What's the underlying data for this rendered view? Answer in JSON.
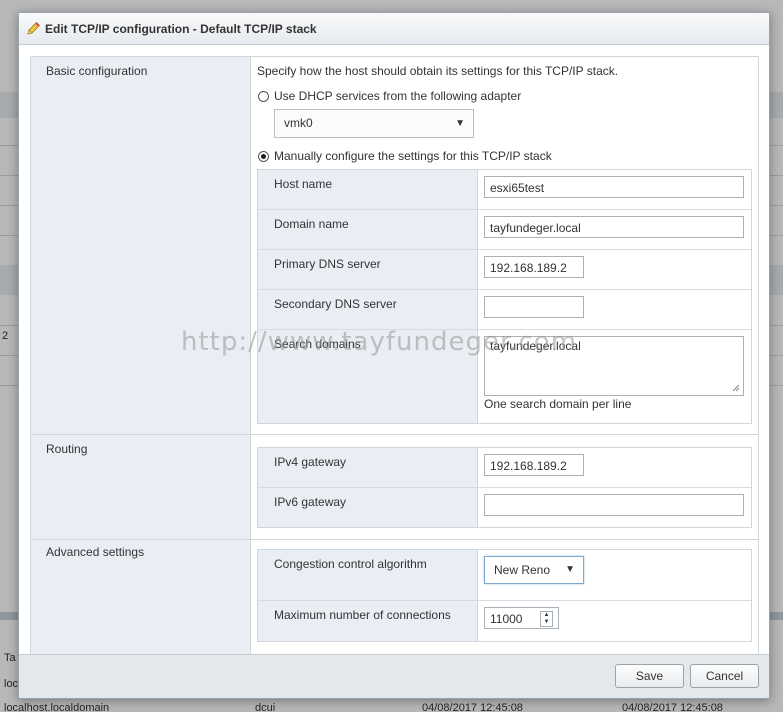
{
  "dialog": {
    "title": "Edit TCP/IP configuration - Default TCP/IP stack",
    "title_icon": "pencil-icon",
    "save_label": "Save",
    "cancel_label": "Cancel"
  },
  "background": {
    "stray_text": "2",
    "tab_fragment": "Ta",
    "host_fragment": "loc",
    "row_host": "localhost.localdomain",
    "row_user": "dcui",
    "row_date1": "04/08/2017 12:45:08",
    "row_date2": "04/08/2017 12:45:08"
  },
  "basic": {
    "section_label": "Basic configuration",
    "description": "Specify how the host should obtain its settings for this TCP/IP stack.",
    "dhcp_label": "Use DHCP services from the following adapter",
    "dhcp_selected": false,
    "adapter_value": "vmk0",
    "manual_label": "Manually configure the settings for this TCP/IP stack",
    "manual_selected": true,
    "fields": {
      "host_name_label": "Host name",
      "host_name_value": "esxi65test",
      "domain_name_label": "Domain name",
      "domain_name_value": "tayfundeger.local",
      "primary_dns_label": "Primary DNS server",
      "primary_dns_value": "192.168.189.2",
      "secondary_dns_label": "Secondary DNS server",
      "secondary_dns_value": "",
      "search_domains_label": "Search domains",
      "search_domains_value": "tayfundeger.local",
      "search_domains_hint": "One search domain per line"
    }
  },
  "routing": {
    "section_label": "Routing",
    "ipv4_label": "IPv4 gateway",
    "ipv4_value": "192.168.189.2",
    "ipv6_label": "IPv6 gateway",
    "ipv6_value": ""
  },
  "advanced": {
    "section_label": "Advanced settings",
    "congestion_label": "Congestion control algorithm",
    "congestion_value": "New Reno",
    "max_conn_label": "Maximum number of connections",
    "max_conn_value": "11000"
  },
  "watermark": "http://www.tayfundeger.com"
}
